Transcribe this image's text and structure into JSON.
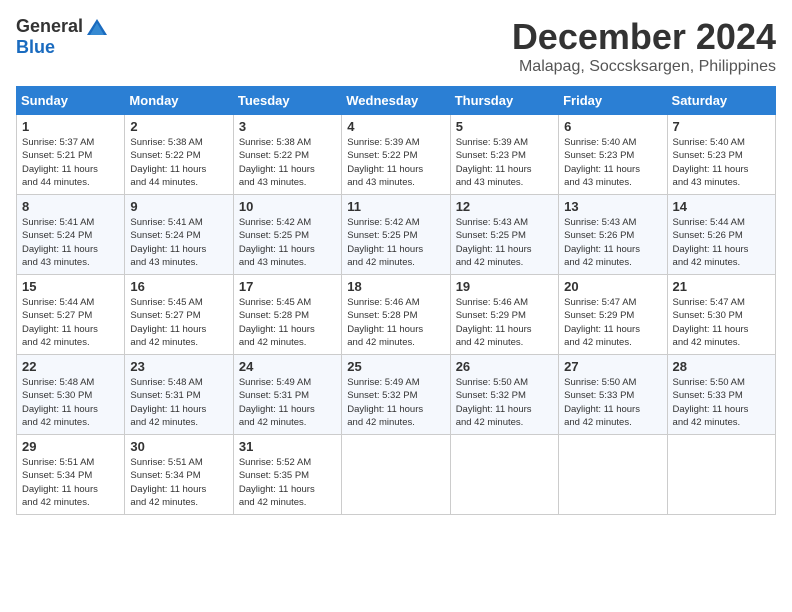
{
  "logo": {
    "general": "General",
    "blue": "Blue"
  },
  "title": "December 2024",
  "location": "Malapag, Soccsksargen, Philippines",
  "days_of_week": [
    "Sunday",
    "Monday",
    "Tuesday",
    "Wednesday",
    "Thursday",
    "Friday",
    "Saturday"
  ],
  "weeks": [
    [
      {
        "day": "1",
        "sunrise": "5:37 AM",
        "sunset": "5:21 PM",
        "daylight": "11 hours and 44 minutes."
      },
      {
        "day": "2",
        "sunrise": "5:38 AM",
        "sunset": "5:22 PM",
        "daylight": "11 hours and 44 minutes."
      },
      {
        "day": "3",
        "sunrise": "5:38 AM",
        "sunset": "5:22 PM",
        "daylight": "11 hours and 43 minutes."
      },
      {
        "day": "4",
        "sunrise": "5:39 AM",
        "sunset": "5:22 PM",
        "daylight": "11 hours and 43 minutes."
      },
      {
        "day": "5",
        "sunrise": "5:39 AM",
        "sunset": "5:23 PM",
        "daylight": "11 hours and 43 minutes."
      },
      {
        "day": "6",
        "sunrise": "5:40 AM",
        "sunset": "5:23 PM",
        "daylight": "11 hours and 43 minutes."
      },
      {
        "day": "7",
        "sunrise": "5:40 AM",
        "sunset": "5:23 PM",
        "daylight": "11 hours and 43 minutes."
      }
    ],
    [
      {
        "day": "8",
        "sunrise": "5:41 AM",
        "sunset": "5:24 PM",
        "daylight": "11 hours and 43 minutes."
      },
      {
        "day": "9",
        "sunrise": "5:41 AM",
        "sunset": "5:24 PM",
        "daylight": "11 hours and 43 minutes."
      },
      {
        "day": "10",
        "sunrise": "5:42 AM",
        "sunset": "5:25 PM",
        "daylight": "11 hours and 43 minutes."
      },
      {
        "day": "11",
        "sunrise": "5:42 AM",
        "sunset": "5:25 PM",
        "daylight": "11 hours and 42 minutes."
      },
      {
        "day": "12",
        "sunrise": "5:43 AM",
        "sunset": "5:25 PM",
        "daylight": "11 hours and 42 minutes."
      },
      {
        "day": "13",
        "sunrise": "5:43 AM",
        "sunset": "5:26 PM",
        "daylight": "11 hours and 42 minutes."
      },
      {
        "day": "14",
        "sunrise": "5:44 AM",
        "sunset": "5:26 PM",
        "daylight": "11 hours and 42 minutes."
      }
    ],
    [
      {
        "day": "15",
        "sunrise": "5:44 AM",
        "sunset": "5:27 PM",
        "daylight": "11 hours and 42 minutes."
      },
      {
        "day": "16",
        "sunrise": "5:45 AM",
        "sunset": "5:27 PM",
        "daylight": "11 hours and 42 minutes."
      },
      {
        "day": "17",
        "sunrise": "5:45 AM",
        "sunset": "5:28 PM",
        "daylight": "11 hours and 42 minutes."
      },
      {
        "day": "18",
        "sunrise": "5:46 AM",
        "sunset": "5:28 PM",
        "daylight": "11 hours and 42 minutes."
      },
      {
        "day": "19",
        "sunrise": "5:46 AM",
        "sunset": "5:29 PM",
        "daylight": "11 hours and 42 minutes."
      },
      {
        "day": "20",
        "sunrise": "5:47 AM",
        "sunset": "5:29 PM",
        "daylight": "11 hours and 42 minutes."
      },
      {
        "day": "21",
        "sunrise": "5:47 AM",
        "sunset": "5:30 PM",
        "daylight": "11 hours and 42 minutes."
      }
    ],
    [
      {
        "day": "22",
        "sunrise": "5:48 AM",
        "sunset": "5:30 PM",
        "daylight": "11 hours and 42 minutes."
      },
      {
        "day": "23",
        "sunrise": "5:48 AM",
        "sunset": "5:31 PM",
        "daylight": "11 hours and 42 minutes."
      },
      {
        "day": "24",
        "sunrise": "5:49 AM",
        "sunset": "5:31 PM",
        "daylight": "11 hours and 42 minutes."
      },
      {
        "day": "25",
        "sunrise": "5:49 AM",
        "sunset": "5:32 PM",
        "daylight": "11 hours and 42 minutes."
      },
      {
        "day": "26",
        "sunrise": "5:50 AM",
        "sunset": "5:32 PM",
        "daylight": "11 hours and 42 minutes."
      },
      {
        "day": "27",
        "sunrise": "5:50 AM",
        "sunset": "5:33 PM",
        "daylight": "11 hours and 42 minutes."
      },
      {
        "day": "28",
        "sunrise": "5:50 AM",
        "sunset": "5:33 PM",
        "daylight": "11 hours and 42 minutes."
      }
    ],
    [
      {
        "day": "29",
        "sunrise": "5:51 AM",
        "sunset": "5:34 PM",
        "daylight": "11 hours and 42 minutes."
      },
      {
        "day": "30",
        "sunrise": "5:51 AM",
        "sunset": "5:34 PM",
        "daylight": "11 hours and 42 minutes."
      },
      {
        "day": "31",
        "sunrise": "5:52 AM",
        "sunset": "5:35 PM",
        "daylight": "11 hours and 42 minutes."
      },
      null,
      null,
      null,
      null
    ]
  ],
  "labels": {
    "sunrise": "Sunrise:",
    "sunset": "Sunset:",
    "daylight": "Daylight:"
  }
}
